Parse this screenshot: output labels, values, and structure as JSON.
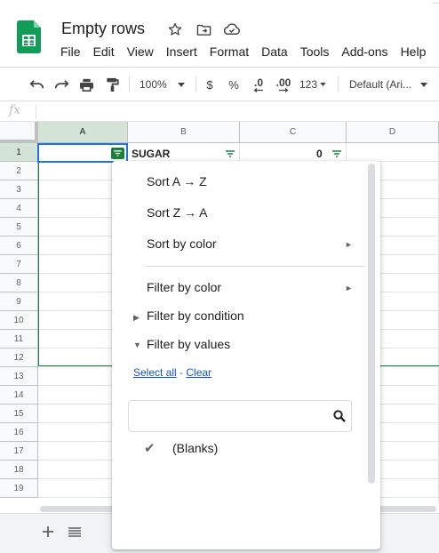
{
  "document": {
    "title": "Empty rows"
  },
  "menu": [
    "File",
    "Edit",
    "View",
    "Insert",
    "Format",
    "Data",
    "Tools",
    "Add-ons",
    "Help"
  ],
  "toolbar": {
    "zoom": "100%",
    "currency": "$",
    "percent": "%",
    "decrease_decimal": ".0",
    "increase_decimal": ".00",
    "more_formats": "123",
    "font": "Default (Ari..."
  },
  "formula_bar": {
    "fx": "fx"
  },
  "columns": [
    "A",
    "B",
    "C",
    "D"
  ],
  "rows": [
    "1",
    "2",
    "3",
    "4",
    "5",
    "6",
    "7",
    "8",
    "9",
    "10",
    "11",
    "12",
    "13",
    "14",
    "15",
    "16",
    "17",
    "18",
    "19"
  ],
  "cells": {
    "B1": "SUGAR",
    "C1": "0"
  },
  "filter_menu": {
    "sort_az": "Sort A → Z",
    "sort_za": "Sort Z → A",
    "sort_by_color": "Sort by color",
    "filter_by_color": "Filter by color",
    "filter_by_condition": "Filter by condition",
    "filter_by_values": "Filter by values",
    "select_all": "Select all",
    "link_separator": " - ",
    "clear": "Clear",
    "search_value": "",
    "values": [
      {
        "label": "(Blanks)",
        "checked": true
      }
    ]
  },
  "colors": {
    "sheets_green": "#0f9d58",
    "filter_green": "#188038",
    "selection_blue": "#1a73e8",
    "link_blue": "#1155cc"
  }
}
